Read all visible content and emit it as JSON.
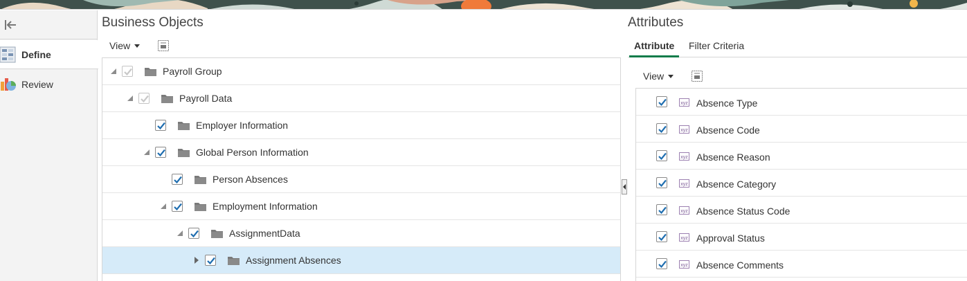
{
  "colors": {
    "accent": "#0e7c4a",
    "check": "#1f6eb0",
    "selected_row": "#d6ebf9",
    "folder": "#777777"
  },
  "sidebar": {
    "collapse_icon": "collapse-left-icon",
    "items": [
      {
        "label": "Define",
        "icon": "define-grid-icon",
        "active": true
      },
      {
        "label": "Review",
        "icon": "review-chart-icon",
        "active": false
      }
    ]
  },
  "left_panel": {
    "title": "Business Objects",
    "view_label": "View",
    "rows": [
      {
        "label": "Payroll Group",
        "disclosure": "expanded",
        "checked": true,
        "disabled": true,
        "selected": false
      },
      {
        "label": "Payroll Data",
        "disclosure": "expanded",
        "checked": true,
        "disabled": true,
        "selected": false
      },
      {
        "label": "Employer Information",
        "disclosure": "none",
        "checked": true,
        "disabled": false,
        "selected": false
      },
      {
        "label": "Global Person Information",
        "disclosure": "expanded",
        "checked": true,
        "disabled": false,
        "selected": false
      },
      {
        "label": "Person Absences",
        "disclosure": "none",
        "checked": true,
        "disabled": false,
        "selected": false
      },
      {
        "label": "Employment Information",
        "disclosure": "expanded",
        "checked": true,
        "disabled": false,
        "selected": false
      },
      {
        "label": "AssignmentData",
        "disclosure": "expanded",
        "checked": true,
        "disabled": false,
        "selected": false
      },
      {
        "label": "Assignment Absences",
        "disclosure": "collapsed",
        "checked": true,
        "disabled": false,
        "selected": true
      }
    ]
  },
  "right_panel": {
    "title": "Attributes",
    "tabs": [
      {
        "label": "Attribute",
        "active": true
      },
      {
        "label": "Filter Criteria",
        "active": false
      }
    ],
    "view_label": "View",
    "rows": [
      {
        "label": "Absence Type",
        "checked": true
      },
      {
        "label": "Absence Code",
        "checked": true
      },
      {
        "label": "Absence Reason",
        "checked": true
      },
      {
        "label": "Absence Category",
        "checked": true
      },
      {
        "label": "Absence Status Code",
        "checked": true
      },
      {
        "label": "Approval Status",
        "checked": true
      },
      {
        "label": "Absence Comments",
        "checked": true
      }
    ]
  }
}
